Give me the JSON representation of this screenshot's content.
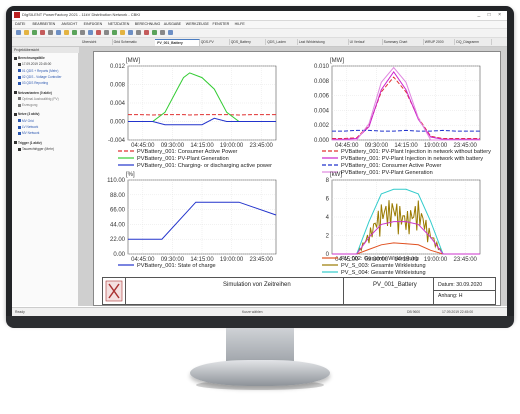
{
  "window": {
    "title": "DIgSILENT PowerFactory 2021 - 11kV Distribution Network - CBKI",
    "controls": "_ □ ×"
  },
  "menu": [
    "DATEI",
    "BEARBEITEN",
    "ANSICHT",
    "EINFÜGEN",
    "NETZDATEN",
    "BERECHNUNG",
    "AUSGABE",
    "WERKZEUGE",
    "FENSTER",
    "HILFE"
  ],
  "tabs": [
    {
      "label": "Übersicht"
    },
    {
      "label": "Grid Schematic"
    },
    {
      "label": "PV_001_Battery",
      "active": true
    },
    {
      "label": "QDS-PV"
    },
    {
      "label": "QDS_Battery"
    },
    {
      "label": "QDS_Laden"
    },
    {
      "label": "Last Wirkleistung"
    },
    {
      "label": "UI Verlauf"
    },
    {
      "label": "Summary Chart"
    },
    {
      "label": "WRUP 2000"
    },
    {
      "label": "DQ_Diagramm"
    }
  ],
  "sidebar": {
    "header": "Projektübersicht",
    "items": [
      {
        "label": "Berechnungsfälle",
        "color": "#333333"
      },
      {
        "label": "17.09.2019 22:45:00",
        "color": "#333333"
      },
      {
        "label": "01 QDS + Reports (Mehr)",
        "color": "#2b57b0"
      },
      {
        "label": "02 QDS - Voltage Controller",
        "color": "#2b57b0"
      },
      {
        "label": "03 QDS Reporting",
        "color": "#2b57b0"
      },
      {
        "label": "Netzvarianten (0 aktiv)",
        "color": "#333333"
      },
      {
        "label": "Optimal Ausbaufähig (PV)",
        "color": "#777777"
      },
      {
        "label": "Erzeugung",
        "color": "#777777"
      },
      {
        "label": "Netze (3 aktiv)",
        "color": "#333333"
      },
      {
        "label": "MV Grid",
        "color": "#2b57b0"
      },
      {
        "label": "LV Network",
        "color": "#2b57b0"
      },
      {
        "label": "MV Network",
        "color": "#2b57b0"
      },
      {
        "label": "Trigger (1 aktiv)",
        "color": "#333333"
      },
      {
        "label": "Tauwechtrigger (Mehr)",
        "color": "#333333"
      }
    ]
  },
  "status": {
    "left": "Ready",
    "center": "Kurze wählen",
    "right1": "DB 9600",
    "right2": "17.09.2019 22:45:00"
  },
  "footer": {
    "title": "Simulation von Zeitreihen",
    "name": "PV_001_Battery",
    "date_label": "Datum:",
    "date_value": "30.09.2020",
    "sheet_label": "Anhang:",
    "sheet_value": "H"
  },
  "chart_data": [
    {
      "type": "line",
      "unit": "[MW]",
      "ylim": [
        -0.004,
        0.012
      ],
      "yticks": [
        "0.012",
        "0.008",
        "0.004",
        "0.000",
        "-0.004"
      ],
      "xticks": [
        "04:45:00",
        "09:30:00",
        "14:15:00",
        "19:00:00",
        "23:45:00"
      ],
      "x": [
        0,
        2,
        4,
        6,
        8,
        9,
        10,
        12,
        14,
        16,
        18,
        20,
        24
      ],
      "series": [
        {
          "name": "PVBattery_001: Consumer Active Power",
          "color": "#e03030",
          "dash": "4,2",
          "values": [
            0.0015,
            0.0015,
            0.0014,
            0.0015,
            0.0015,
            0.0015,
            0.0014,
            0.0015,
            0.0015,
            0.0015,
            0.0014,
            0.0015,
            0.0015
          ]
        },
        {
          "name": "PVBattery_001: PV-Plant Generation",
          "color": "#33cc33",
          "dash": "",
          "values": [
            0,
            0,
            0,
            0.002,
            0.007,
            0.0095,
            0.0105,
            0.0095,
            0.007,
            0.002,
            0,
            0,
            0
          ]
        },
        {
          "name": "PVBattery_001: Charging- or discharging active power",
          "color": "#2233cc",
          "dash": "",
          "values": [
            0,
            0,
            0,
            -0.0007,
            -0.0007,
            -0.0007,
            -0.0007,
            -0.0007,
            0.0007,
            0,
            0,
            0,
            0
          ]
        }
      ]
    },
    {
      "type": "line",
      "unit": "[MW]",
      "ylim": [
        0,
        0.01
      ],
      "yticks": [
        "0.010",
        "0.008",
        "0.006",
        "0.004",
        "0.002",
        "0.000"
      ],
      "xticks": [
        "04:45:00",
        "09:30:00",
        "14:15:00",
        "19:00:00",
        "23:45:00"
      ],
      "x": [
        0,
        2,
        4,
        6,
        8,
        10,
        12,
        14,
        16,
        18,
        20,
        24
      ],
      "series": [
        {
          "name": "PVBattery_001: PV-Plant Injection in network without battery",
          "color": "#e03030",
          "dash": "4,2",
          "values": [
            0.0002,
            0.0002,
            0.0003,
            0.002,
            0.0065,
            0.0085,
            0.0065,
            0.003,
            0.0005,
            0.0002,
            0.0002,
            0.0002
          ]
        },
        {
          "name": "PVBattery_001: PV-Plant Injection in network with battery",
          "color": "#cc22cc",
          "dash": "",
          "values": [
            0.0001,
            0.0001,
            0.0002,
            0.0018,
            0.0068,
            0.0092,
            0.0068,
            0.0028,
            0.0004,
            0.0001,
            0.0001,
            0.0001
          ]
        },
        {
          "name": "PVBattery_001: Consumer Active Power",
          "color": "#2233cc",
          "dash": "4,2",
          "values": [
            0.0012,
            0.0012,
            0.0013,
            0.0013,
            0.0012,
            0.0012,
            0.0013,
            0.0012,
            0.0012,
            0.0013,
            0.0012,
            0.0012
          ]
        },
        {
          "name": "PVBattery_001: PV-Plant Generation",
          "color": "#e088e0",
          "dash": "",
          "values": [
            0,
            0,
            0,
            0.0022,
            0.0078,
            0.0098,
            0.0078,
            0.003,
            0,
            0,
            0,
            0
          ]
        }
      ]
    },
    {
      "type": "line",
      "unit": "[%]",
      "ylim": [
        0,
        110
      ],
      "yticks": [
        "110.00",
        "88.00",
        "66.00",
        "44.00",
        "22.00",
        "0.00"
      ],
      "xticks": [
        "04:45:00",
        "09:30:00",
        "14:15:00",
        "19:00:00",
        "23:45:00"
      ],
      "x": [
        0,
        4,
        5.5,
        11,
        12,
        14,
        18,
        24
      ],
      "series": [
        {
          "name": "PVBattery_001: State of charge",
          "color": "#2233cc",
          "dash": "",
          "values": [
            22,
            22,
            22,
            77,
            77,
            77,
            77,
            58
          ]
        }
      ]
    },
    {
      "type": "line",
      "unit": "[kW]",
      "ylim": [
        0,
        8
      ],
      "yticks": [
        "8",
        "6",
        "4",
        "2",
        "0"
      ],
      "xticks": [
        "04:45:00",
        "09:30:00",
        "14:15:00",
        "19:00:00",
        "23:45:00"
      ],
      "x": [
        0,
        4,
        6,
        8,
        10,
        12,
        14,
        16,
        18,
        20,
        24
      ],
      "series": [
        {
          "name": "PV_002: Gesamte Wirkleistung",
          "color": "#e05020",
          "dash": "",
          "values": [
            0,
            0,
            0.5,
            1.0,
            1.2,
            1.1,
            1.0,
            0.4,
            0,
            0,
            0
          ]
        },
        {
          "name": "PV_S_003: Gesamte Wirkleistung",
          "color": "#9a7a00",
          "dash": "",
          "values": [
            0,
            0,
            2.5,
            5.5,
            6.0,
            4.5,
            5.8,
            2.5,
            0,
            0,
            0
          ]
        },
        {
          "name": "PV_S_004: Gesamte Wirkleistung",
          "color": "#33cccc",
          "dash": "",
          "values": [
            0,
            0,
            3.5,
            6.5,
            7.0,
            7.0,
            6.5,
            3.5,
            0,
            0,
            0
          ]
        },
        {
          "name": "PV_S_004: m:Psum:bus1",
          "color": "#cc33cc",
          "dash": "",
          "values": [
            0,
            0,
            1.8,
            3.2,
            3.5,
            3.5,
            3.2,
            1.8,
            0,
            0,
            0
          ]
        }
      ]
    }
  ]
}
